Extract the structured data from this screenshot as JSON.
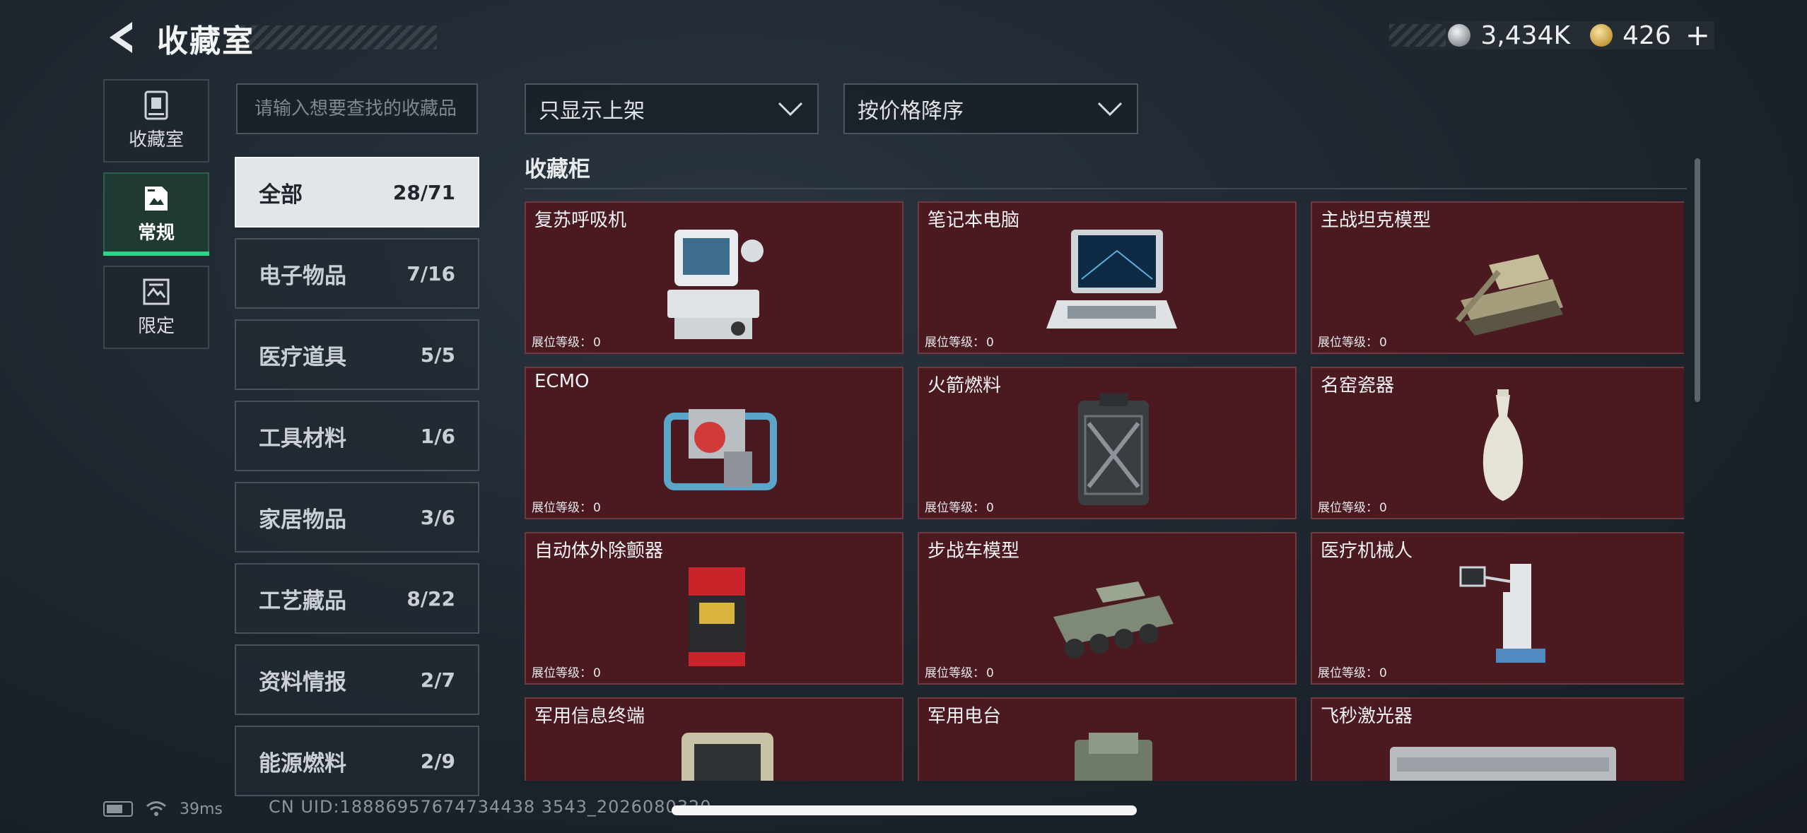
{
  "header": {
    "back_icon": "back-arrow-icon",
    "title": "收藏室",
    "currency": [
      {
        "icon": "silver-coin-icon",
        "value": "3,434K"
      },
      {
        "icon": "gold-coin-icon",
        "value": "426"
      }
    ],
    "add_label": "+"
  },
  "side_nav": [
    {
      "label": "收藏室",
      "icon": "collection-room-icon",
      "active": false
    },
    {
      "label": "常规",
      "icon": "regular-icon",
      "active": true
    },
    {
      "label": "限定",
      "icon": "limited-icon",
      "active": false
    }
  ],
  "search": {
    "placeholder": "请输入想要查找的收藏品",
    "value": ""
  },
  "categories": [
    {
      "name": "全部",
      "count": "28/71",
      "active": true
    },
    {
      "name": "电子物品",
      "count": "7/16"
    },
    {
      "name": "医疗道具",
      "count": "5/5"
    },
    {
      "name": "工具材料",
      "count": "1/6"
    },
    {
      "name": "家居物品",
      "count": "3/6"
    },
    {
      "name": "工艺藏品",
      "count": "8/22"
    },
    {
      "name": "资料情报",
      "count": "2/7"
    },
    {
      "name": "能源燃料",
      "count": "2/9"
    }
  ],
  "filters": {
    "display_filter": "只显示上架",
    "sort": "按价格降序",
    "chevron_icon": "chevron-down-icon"
  },
  "section": {
    "title": "收藏柜"
  },
  "items": [
    {
      "name": "复苏呼吸机",
      "level_label": "展位等级：",
      "level": "0"
    },
    {
      "name": "笔记本电脑",
      "level_label": "展位等级：",
      "level": "0"
    },
    {
      "name": "主战坦克模型",
      "level_label": "展位等级：",
      "level": "0"
    },
    {
      "name": "ECMO",
      "level_label": "展位等级：",
      "level": "0"
    },
    {
      "name": "火箭燃料",
      "level_label": "展位等级：",
      "level": "0"
    },
    {
      "name": "名窑瓷器",
      "level_label": "展位等级：",
      "level": "0"
    },
    {
      "name": "自动体外除颤器",
      "level_label": "展位等级：",
      "level": "0"
    },
    {
      "name": "步战车模型",
      "level_label": "展位等级：",
      "level": "0"
    },
    {
      "name": "医疗机械人",
      "level_label": "展位等级：",
      "level": "0"
    },
    {
      "name": "军用信息终端",
      "level_label": "",
      "level": ""
    },
    {
      "name": "军用电台",
      "level_label": "",
      "level": ""
    },
    {
      "name": "飞秒激光器",
      "level_label": "",
      "level": ""
    }
  ],
  "status": {
    "ping": "39ms",
    "uid": "CN UID:18886957674734438 3543_2026080320"
  },
  "colors": {
    "card_bg": "#4a1a20",
    "active_tab_accent": "#2fd38a",
    "page_bg": "#1d252d"
  }
}
